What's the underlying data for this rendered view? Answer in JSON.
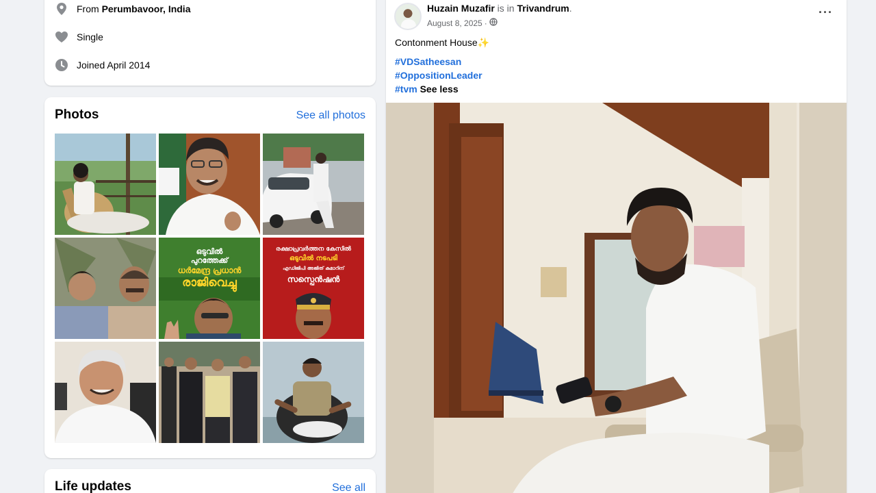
{
  "intro": {
    "from_prefix": "From",
    "from_place": "Perumbavoor, India",
    "relationship": "Single",
    "joined": "Joined April 2014",
    "icons": [
      "location-pin-icon",
      "heart-icon",
      "clock-icon"
    ]
  },
  "photos": {
    "title": "Photos",
    "see_all": "See all photos",
    "thumb_text": {
      "p5_line1": "ഒടുവിൽ",
      "p5_line2": "പുറത്തേക്ക്",
      "p5_line3": "ധർമേന്ദ്ര പ്രധാൻ",
      "p5_line4": "രാജിവെച്ചു",
      "p6_line1": "രക്ഷാപ്രവർത്തന കേസിൽ",
      "p6_line2": "ഒടുവിൽ നടപടി",
      "p6_line3": "എഡിജിപി അജിത് കുമാറിന്",
      "p6_line4": "സസ്പെൻഷൻ"
    }
  },
  "life_updates": {
    "title": "Life updates",
    "see_all": "See all"
  },
  "post": {
    "author": "Huzain Muzafir",
    "is_in": "is in",
    "location": "Trivandrum",
    "date": "August 8, 2025",
    "date_sep": "·",
    "more": "···",
    "caption": "Contonment House✨",
    "hashtags": [
      "#VDSatheesan",
      "#OppositionLeader",
      "#tvm"
    ],
    "see_less": "See less"
  },
  "colors": {
    "link": "#216fdb",
    "background": "#f0f2f5"
  }
}
